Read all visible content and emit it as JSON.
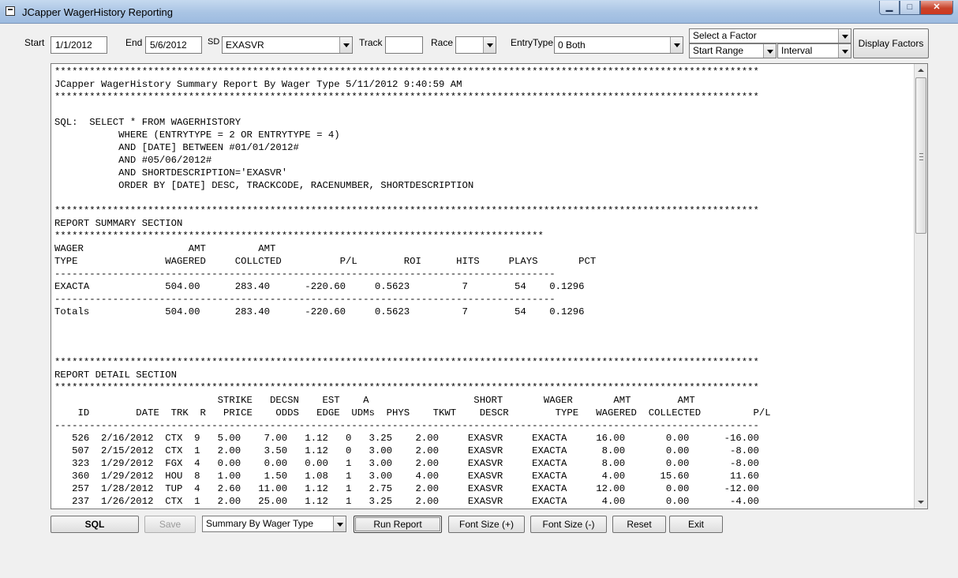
{
  "window": {
    "title": "JCapper WagerHistory Reporting",
    "min_icon": "minimize-icon",
    "max_icon": "maximize-icon",
    "close_icon": "close-icon",
    "min_glyph": "▁",
    "max_glyph": "□",
    "close_glyph": "✕"
  },
  "toolbar": {
    "start_label": "Start",
    "start_value": "1/1/2012",
    "end_label": "End",
    "end_value": "5/6/2012",
    "sd_label": "SD",
    "sd_value": "EXASVR",
    "track_label": "Track",
    "track_value": "",
    "race_label": "Race",
    "race_value": "",
    "entrytype_label": "EntryType",
    "entrytype_value": "0 Both",
    "factor_value": "Select a Factor",
    "range_value": "Start Range",
    "interval_value": "Interval",
    "display_factors_label": "Display Factors"
  },
  "report": {
    "lines": [
      "*************************************************************************************************************************",
      "JCapper WagerHistory Summary Report By Wager Type 5/11/2012 9:40:59 AM",
      "*************************************************************************************************************************",
      "",
      "SQL:  SELECT * FROM WAGERHISTORY",
      "           WHERE (ENTRYTYPE = 2 OR ENTRYTYPE = 4)",
      "           AND [DATE] BETWEEN #01/01/2012#",
      "           AND #05/06/2012#",
      "           AND SHORTDESCRIPTION='EXASVR'",
      "           ORDER BY [DATE] DESC, TRACKCODE, RACENUMBER, SHORTDESCRIPTION",
      "",
      "*************************************************************************************************************************",
      "REPORT SUMMARY SECTION",
      "************************************************************************************",
      "WAGER                  AMT         AMT",
      "TYPE               WAGERED     COLLCTED          P/L        ROI      HITS     PLAYS       PCT",
      "--------------------------------------------------------------------------------------",
      "EXACTA             504.00      283.40      -220.60     0.5623         7        54    0.1296",
      "--------------------------------------------------------------------------------------",
      "Totals             504.00      283.40      -220.60     0.5623         7        54    0.1296",
      "",
      "",
      "",
      "*************************************************************************************************************************",
      "REPORT DETAIL SECTION",
      "*************************************************************************************************************************",
      "                            STRIKE   DECSN    EST    A                  SHORT       WAGER       AMT        AMT",
      "    ID        DATE  TRK  R   PRICE    ODDS   EDGE  UDMs  PHYS    TKWT    DESCR        TYPE   WAGERED  COLLECTED         P/L",
      "-------------------------------------------------------------------------------------------------------------------------",
      "   526  2/16/2012  CTX  9   5.00    7.00   1.12   0   3.25    2.00     EXASVR     EXACTA     16.00       0.00      -16.00",
      "   507  2/15/2012  CTX  1   2.00    3.50   1.12   0   3.00    2.00     EXASVR     EXACTA      8.00       0.00       -8.00",
      "   323  1/29/2012  FGX  4   0.00    0.00   0.00   1   3.00    2.00     EXASVR     EXACTA      8.00       0.00       -8.00",
      "   360  1/29/2012  HOU  8   1.00    1.50   1.08   1   3.00    4.00     EXASVR     EXACTA      4.00      15.60       11.60",
      "   257  1/28/2012  TUP  4   2.60   11.00   1.12   1   2.75    2.00     EXASVR     EXACTA     12.00       0.00      -12.00",
      "   237  1/26/2012  CTX  1   2.00   25.00   1.12   1   3.25    2.00     EXASVR     EXACTA      4.00       0.00       -4.00"
    ]
  },
  "buttons": {
    "sql": "SQL",
    "save": "Save",
    "report_type": "Summary By Wager Type",
    "run_report": "Run Report",
    "font_plus": "Font Size (+)",
    "font_minus": "Font Size (-)",
    "reset": "Reset",
    "exit": "Exit"
  }
}
